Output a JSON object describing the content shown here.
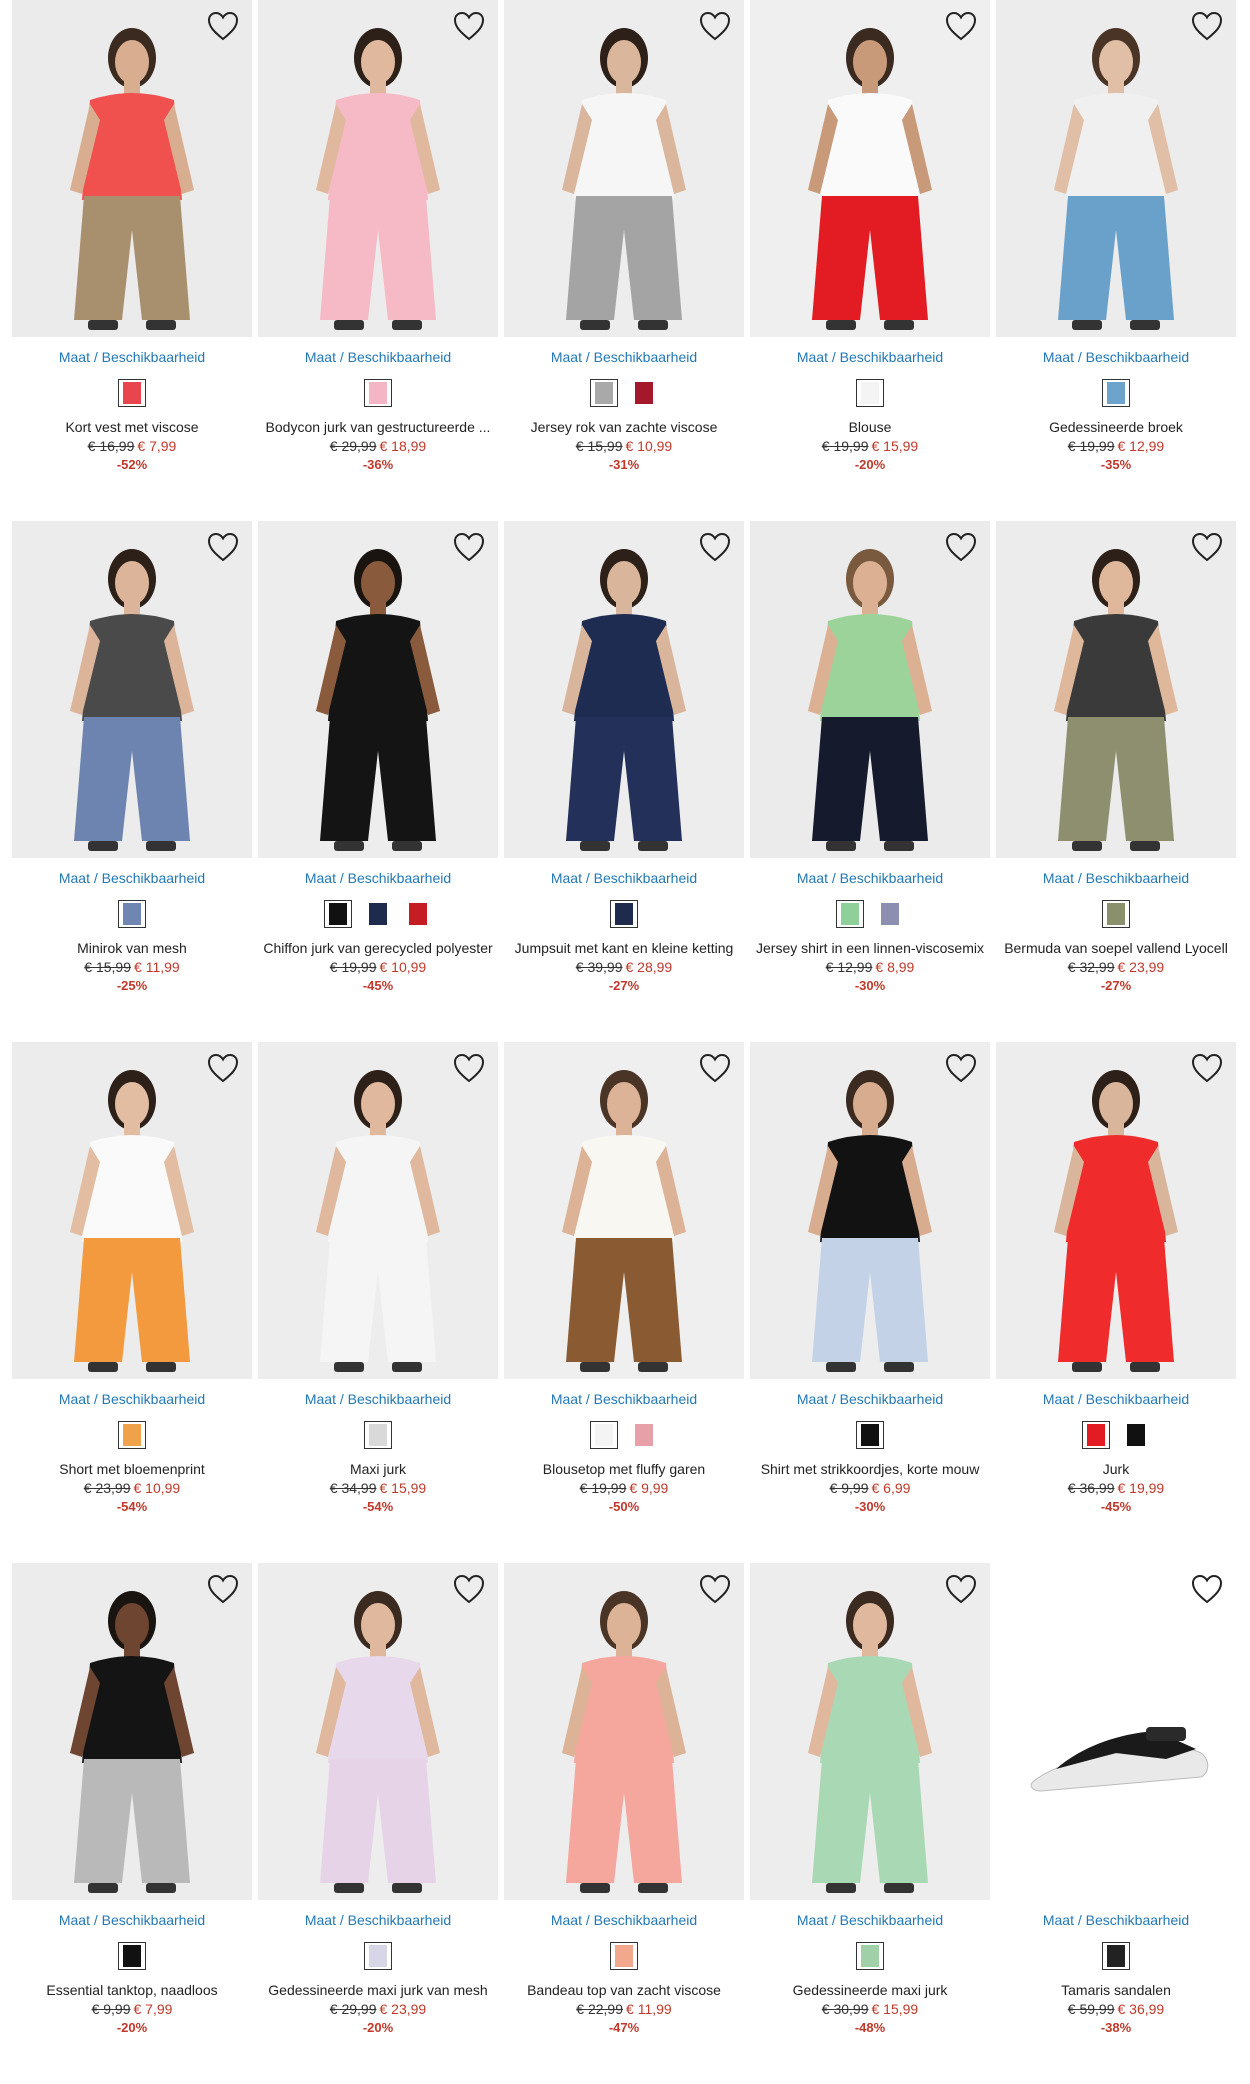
{
  "availability_label": "Maat / Beschikbaarheid",
  "colors": {
    "link": "#2378b5",
    "sale": "#c0392b"
  },
  "products": [
    {
      "name": "Kort vest met viscose",
      "old_price": "€ 16,99",
      "new_price": "€ 7,99",
      "discount": "-52%",
      "swatches": [
        "#e8454f"
      ],
      "bg": "#ebebeb",
      "top": "#f0504e",
      "bottom": "#a8906f",
      "skin": "#d9ae90",
      "hair": "#3b2a20",
      "icon": "heart-icon"
    },
    {
      "name": "Bodycon jurk van gestructureerde ...",
      "old_price": "€ 29,99",
      "new_price": "€ 18,99",
      "discount": "-36%",
      "swatches": [
        "#f4b6c4"
      ],
      "bg": "#ececec",
      "top": "#f6b9c6",
      "bottom": "#f6b9c6",
      "skin": "#e0b89e",
      "hair": "#2d2019",
      "icon": "heart-icon"
    },
    {
      "name": "Jersey rok van zachte viscose",
      "old_price": "€ 15,99",
      "new_price": "€ 10,99",
      "discount": "-31%",
      "swatches": [
        "#a9a9a9",
        "#a3182a"
      ],
      "bg": "#ededed",
      "top": "#f6f6f6",
      "bottom": "#a4a4a4",
      "skin": "#d9b69c",
      "hair": "#2d2019",
      "icon": "heart-icon"
    },
    {
      "name": "Blouse",
      "old_price": "€ 19,99",
      "new_price": "€ 15,99",
      "discount": "-20%",
      "swatches": [
        "#f4f4f4"
      ],
      "bg": "#efefef",
      "top": "#fafafa",
      "bottom": "#e31c23",
      "skin": "#c99a7a",
      "hair": "#3b2a20",
      "icon": "heart-icon"
    },
    {
      "name": "Gedessineerde broek",
      "old_price": "€ 19,99",
      "new_price": "€ 12,99",
      "discount": "-35%",
      "swatches": [
        "#6ea4cc"
      ],
      "bg": "#ececec",
      "top": "#f0f0f0",
      "bottom": "#6aa1cb",
      "skin": "#e0bfa6",
      "hair": "#4a3426",
      "icon": "heart-icon"
    },
    {
      "name": "Minirok van mesh",
      "old_price": "€ 15,99",
      "new_price": "€ 11,99",
      "discount": "-25%",
      "swatches": [
        "#6f86b3"
      ],
      "bg": "#ececec",
      "top": "#4a4a4a",
      "bottom": "#6d84b0",
      "skin": "#dcb49a",
      "hair": "#2d2019",
      "icon": "heart-icon"
    },
    {
      "name": "Chiffon jurk van gerecycled polyester",
      "old_price": "€ 19,99",
      "new_price": "€ 10,99",
      "discount": "-45%",
      "swatches": [
        "#111111",
        "#1e2b4d",
        "#c41d24"
      ],
      "bg": "#ededed",
      "top": "#141414",
      "bottom": "#141414",
      "skin": "#8a5a3c",
      "hair": "#1a1410",
      "icon": "heart-icon"
    },
    {
      "name": "Jumpsuit met kant en kleine ketting",
      "old_price": "€ 39,99",
      "new_price": "€ 28,99",
      "discount": "-27%",
      "swatches": [
        "#1e2b4d"
      ],
      "bg": "#ededed",
      "top": "#1f2c52",
      "bottom": "#22305a",
      "skin": "#d9b59b",
      "hair": "#2d2019",
      "icon": "heart-icon"
    },
    {
      "name": "Jersey shirt in een linnen-viscosemix",
      "old_price": "€ 12,99",
      "new_price": "€ 8,99",
      "discount": "-30%",
      "swatches": [
        "#8fcf9a",
        "#8c8fb0"
      ],
      "bg": "#ebebeb",
      "top": "#9bd39a",
      "bottom": "#151a2c",
      "skin": "#dcb193",
      "hair": "#7a5a3e",
      "icon": "heart-icon"
    },
    {
      "name": "Bermuda van soepel vallend Lyocell",
      "old_price": "€ 32,99",
      "new_price": "€ 23,99",
      "discount": "-27%",
      "swatches": [
        "#8a8f6c"
      ],
      "bg": "#ececec",
      "top": "#3a3a3a",
      "bottom": "#8d8f6f",
      "skin": "#dfb89c",
      "hair": "#2d2019",
      "icon": "heart-icon"
    },
    {
      "name": "Short met bloemenprint",
      "old_price": "€ 23,99",
      "new_price": "€ 10,99",
      "discount": "-54%",
      "swatches": [
        "#f0a24a"
      ],
      "bg": "#ececec",
      "top": "#fafafa",
      "bottom": "#f29a3d",
      "skin": "#e2bda2",
      "hair": "#2d2019",
      "icon": "heart-icon"
    },
    {
      "name": "Maxi jurk",
      "old_price": "€ 34,99",
      "new_price": "€ 15,99",
      "discount": "-54%",
      "swatches": [
        "#d9d9d9"
      ],
      "bg": "#ededed",
      "top": "#f5f5f5",
      "bottom": "#f5f5f5",
      "skin": "#e0b89e",
      "hair": "#2d2019",
      "icon": "heart-icon"
    },
    {
      "name": "Blousetop met fluffy garen",
      "old_price": "€ 19,99",
      "new_price": "€ 9,99",
      "discount": "-50%",
      "swatches": [
        "#f4f4f4",
        "#e8a0a8"
      ],
      "bg": "#efefef",
      "top": "#f8f7f2",
      "bottom": "#8a5a33",
      "skin": "#dcb396",
      "hair": "#4a3426",
      "icon": "heart-icon"
    },
    {
      "name": "Shirt met strikkoordjes, korte mouw",
      "old_price": "€ 9,99",
      "new_price": "€ 6,99",
      "discount": "-30%",
      "swatches": [
        "#111111"
      ],
      "bg": "#ededed",
      "top": "#121212",
      "bottom": "#c3d2e6",
      "skin": "#d8ad8f",
      "hair": "#3b2a20",
      "icon": "heart-icon"
    },
    {
      "name": "Jurk",
      "old_price": "€ 36,99",
      "new_price": "€ 19,99",
      "discount": "-45%",
      "swatches": [
        "#e31c23",
        "#111111"
      ],
      "bg": "#ededed",
      "top": "#ef2b2b",
      "bottom": "#ef2b2b",
      "skin": "#d9b59b",
      "hair": "#2d2019",
      "icon": "heart-icon"
    },
    {
      "name": "Essential tanktop, naadloos",
      "old_price": "€ 9,99",
      "new_price": "€ 7,99",
      "discount": "-20%",
      "swatches": [
        "#111111"
      ],
      "bg": "#ececec",
      "top": "#141414",
      "bottom": "#b9b9b9",
      "skin": "#6e4530",
      "hair": "#1a1410",
      "icon": "heart-icon"
    },
    {
      "name": "Gedessineerde maxi jurk van mesh",
      "old_price": "€ 29,99",
      "new_price": "€ 23,99",
      "discount": "-20%",
      "swatches": [
        "#d6d6e6"
      ],
      "bg": "#ededed",
      "top": "#e8d8ec",
      "bottom": "#e7d3e8",
      "skin": "#e0b89e",
      "hair": "#3b2a20",
      "icon": "heart-icon"
    },
    {
      "name": "Bandeau top van zacht viscose",
      "old_price": "€ 22,99",
      "new_price": "€ 11,99",
      "discount": "-47%",
      "swatches": [
        "#f2a88c"
      ],
      "bg": "#ededed",
      "top": "#f5a79d",
      "bottom": "#f5a79d",
      "skin": "#dcb396",
      "hair": "#4a3426",
      "icon": "heart-icon"
    },
    {
      "name": "Gedessineerde maxi jurk",
      "old_price": "€ 30,99",
      "new_price": "€ 15,99",
      "discount": "-48%",
      "swatches": [
        "#9fd0a8"
      ],
      "bg": "#ededed",
      "top": "#a9d9b4",
      "bottom": "#a9d9b4",
      "skin": "#e0b89e",
      "hair": "#3b2a20",
      "icon": "heart-icon"
    },
    {
      "name": "Tamaris sandalen",
      "old_price": "€ 59,99",
      "new_price": "€ 36,99",
      "discount": "-38%",
      "swatches": [
        "#222222"
      ],
      "bg": "#ffffff",
      "top": "#1a1a1a",
      "bottom": "#1a1a1a",
      "skin": "#ffffff",
      "hair": "#ffffff",
      "icon": "heart-icon",
      "is_shoe": true
    }
  ]
}
